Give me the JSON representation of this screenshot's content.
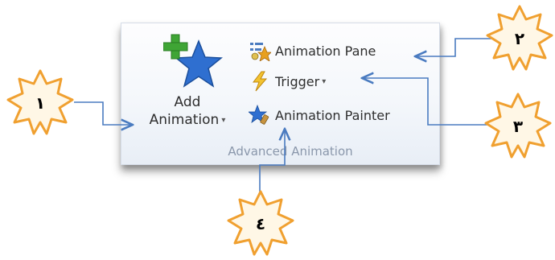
{
  "ribbon": {
    "add_animation_line1": "Add",
    "add_animation_line2": "Animation",
    "animation_pane": "Animation Pane",
    "trigger": "Trigger",
    "animation_painter": "Animation Painter",
    "group_label": "Advanced Animation",
    "dropdown_glyph": "▾"
  },
  "callouts": [
    {
      "number": "١"
    },
    {
      "number": "٢"
    },
    {
      "number": "٣"
    },
    {
      "number": "٤"
    }
  ],
  "colors": {
    "callout_fill": "#fff7e6",
    "callout_stroke": "#f0a030",
    "arrow": "#4a7bc0",
    "star_blue": "#2f6fd0",
    "plus_green": "#3fa535"
  }
}
